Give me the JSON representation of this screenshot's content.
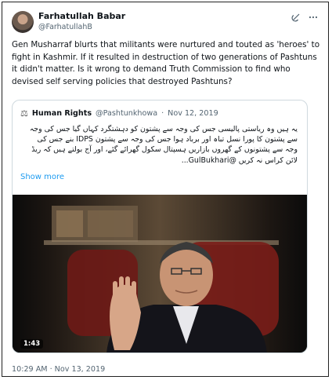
{
  "author": {
    "name": "Farhatullah Babar",
    "handle": "@FarhatullahB"
  },
  "actions": {
    "grok_icon": "grok-icon",
    "more_icon": "more-icon"
  },
  "tweet": {
    "text": "Gen Musharraf blurts that militants were nurtured and touted as 'heroes' to fight in Kashmir. If it resulted in destruction of two generations of Pashtuns it didn't matter. Is it wrong to demand Truth Commission to find who devised self serving policies that destroyed Pashtuns?",
    "timestamp": "10:29 AM · Nov 13, 2019"
  },
  "quoted_tweet": {
    "name": "Human Rights",
    "handle": "@Pashtunkhowa",
    "separator": "·",
    "date": "Nov 12, 2019",
    "text": "یہ ہیں وہ ریاستی پالیسی جس کی وجہ سے پشتون کو دہشتگرد کہاں گیا جس کی وجہ سے پشتون کا پورا نسل تباہ اور برباد ہوا جس کی وجہ سے پشتون IDPS بنے جس کی وجہ سے پشتونوں کے گھروں بازاریں ہسپتال سکول گھرائے گئے، اور آج بولتے ہیں کہ ریڈ لائن کراس نہ کریں @GulBukhari...",
    "show_more": "Show more",
    "video_duration": "1:43"
  }
}
